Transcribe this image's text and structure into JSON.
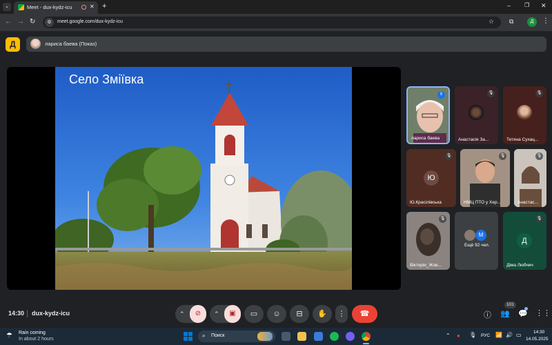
{
  "browser": {
    "tab_title": "Meet - dux-kydz-icu",
    "url": "meet.google.com/dux-kydz-icu",
    "profile_initial": "Д"
  },
  "meet": {
    "presenter_label": "лариса баева (Показ)",
    "slide_title": "Село Зміївка",
    "participants": [
      {
        "name": "лариса баева",
        "letter": ""
      },
      {
        "name": "Анастасія За...",
        "letter": ""
      },
      {
        "name": "Тетяна Сухац...",
        "letter": ""
      },
      {
        "name": "Ю.Красiлiвська",
        "letter": "Ю"
      },
      {
        "name": "НМЦ ПТО у Хер...",
        "letter": ""
      },
      {
        "name": "Анастас...",
        "letter": ""
      },
      {
        "name": "Вікторія_Жов...",
        "letter": ""
      },
      {
        "name": "Ещё 92 чел.",
        "letter": "М"
      },
      {
        "name": "Діма Любчич",
        "letter": "Д"
      }
    ],
    "time": "14:30",
    "meeting_code": "dux-kydz-icu",
    "participant_count": "101"
  },
  "taskbar": {
    "weather_title": "Rain coming",
    "weather_sub": "In about 2 hours",
    "search_placeholder": "Поиск",
    "language": "РУС",
    "clock_time": "14:30",
    "clock_date": "14.05.2025"
  },
  "colors": {
    "meet_bg": "#202124",
    "end_call": "#ea4335",
    "mic_off_bg": "#f9dedc",
    "accent_blue": "#8ab4f8"
  }
}
